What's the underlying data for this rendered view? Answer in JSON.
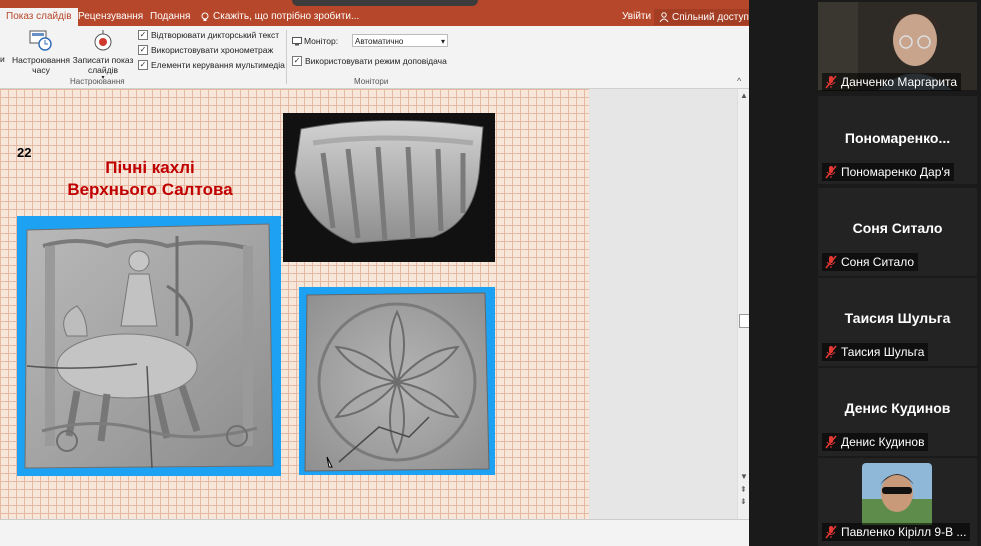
{
  "ribbon": {
    "tabs": [
      "Показ слайдів",
      "Рецензування",
      "Подання"
    ],
    "tell_me": "Скажіть, що потрібно зробити...",
    "sign_in": "Увійти",
    "share": "Спільний доступ",
    "left_cut": "и",
    "btn_rehearse": "Настроювання часу",
    "btn_record": "Записати показ слайдів",
    "checkboxes": [
      "Відтворювати дикторський текст",
      "Використовувати хронометраж",
      "Елементи керування мультимедіа"
    ],
    "group_setup": "Настроювання",
    "monitor_label": "Монітор:",
    "monitor_value": "Автоматично",
    "presenter_view": "Використовувати режим доповідача",
    "group_monitors": "Монітори"
  },
  "slide": {
    "number": "22",
    "title_line1": "Пічні кахлі",
    "title_line2": "Верхнього Салтова",
    "title_color": "#c00000",
    "frame_color": "#1da1f2"
  },
  "participants": [
    {
      "name": "Данченко Маргарита",
      "has_video": true,
      "muted": true
    },
    {
      "display": "Пономаренко...",
      "name": "Пономаренко Дар'я",
      "muted": true
    },
    {
      "display": "Соня Ситало",
      "name": "Соня Ситало",
      "muted": true
    },
    {
      "display": "Таисия Шульга",
      "name": "Таисия Шульга",
      "muted": true
    },
    {
      "display": "Денис Кудинов",
      "name": "Денис Кудинов",
      "muted": true
    },
    {
      "name": "Павленко Кірілл 9-В ...",
      "has_avatar": true,
      "muted": true
    }
  ]
}
